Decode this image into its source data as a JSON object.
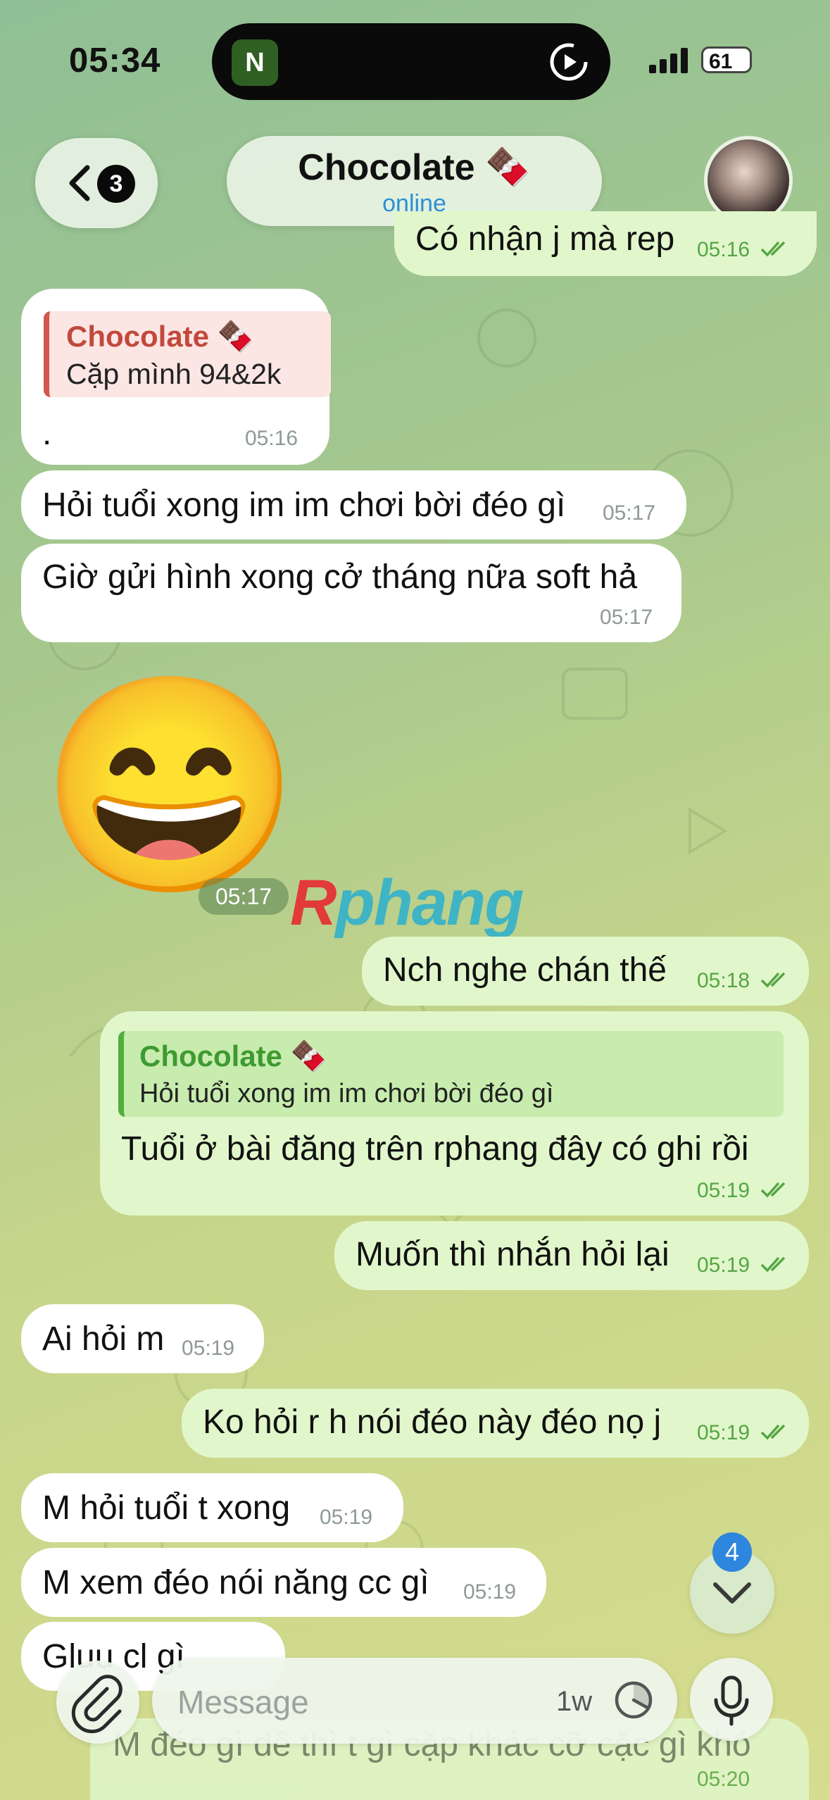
{
  "status_bar": {
    "time": "05:34",
    "island_app_letter": "N",
    "battery": "61"
  },
  "header": {
    "back_badge": "3",
    "title": "Chocolate 🍫",
    "status": "online"
  },
  "messages": {
    "m0": {
      "text": "Có nhận j mà rep",
      "time": "05:16"
    },
    "m1": {
      "reply_name": "Chocolate 🍫",
      "reply_text": "Cặp mình 94&2k",
      "text": ".",
      "time": "05:16"
    },
    "m2": {
      "text": "Hỏi tuổi xong im im chơi bời đéo gì",
      "time": "05:17"
    },
    "m3": {
      "text": "Giờ gửi hình xong cở tháng nữa soft hả",
      "time": "05:17"
    },
    "sticker": {
      "emoji": "😄",
      "time": "05:17"
    },
    "m4": {
      "text": "Nch nghe chán thế",
      "time": "05:18"
    },
    "m5": {
      "reply_name": "Chocolate 🍫",
      "reply_text": "Hỏi tuổi xong im im chơi bời đéo gì",
      "text": "Tuổi ở bài đăng trên rphang đây có ghi rồi",
      "time": "05:19"
    },
    "m6": {
      "text": "Muốn thì nhắn hỏi lại",
      "time": "05:19"
    },
    "m7": {
      "text": "Ai hỏi m",
      "time": "05:19"
    },
    "m8": {
      "text": "Ko hỏi r h nói đéo này đéo nọ j",
      "time": "05:19"
    },
    "m9": {
      "text": "M hỏi tuổi t xong",
      "time": "05:19"
    },
    "m10": {
      "text": "M xem đéo nói năng cc gì",
      "time": "05:19"
    },
    "m11": {
      "text": "Gluu cl gì"
    },
    "m12": {
      "text": "M đéo gì dề thì t gì cặp khác cỡ cặc gì khó",
      "time": "05:20"
    }
  },
  "watermark": {
    "first": "R",
    "rest": "phang"
  },
  "composer": {
    "placeholder": "Message",
    "timer": "1w"
  },
  "scroll_badge": "4",
  "colors": {
    "incoming_bubble": "#ffffff",
    "outgoing_bubble": "#e1f7cb",
    "outgoing_time": "#55a645",
    "reply_accent_in": "#d0584c",
    "reply_accent_out": "#4fae3f",
    "online": "#2b8fd6",
    "badge": "#2e86de"
  }
}
